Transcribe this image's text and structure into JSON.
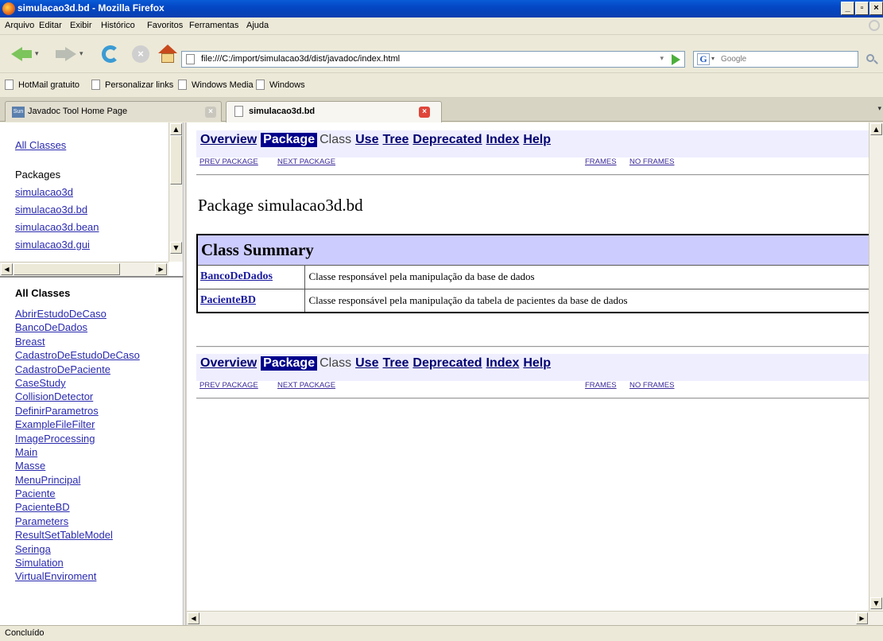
{
  "window": {
    "title": "simulacao3d.bd - Mozilla Firefox"
  },
  "menu": [
    "Arquivo",
    "Editar",
    "Exibir",
    "Histórico",
    "Favoritos",
    "Ferramentas",
    "Ajuda"
  ],
  "urlbar": {
    "url": "file:///C:/import/simulacao3d/dist/javadoc/index.html"
  },
  "search": {
    "placeholder": "Google"
  },
  "bookmarks": [
    "HotMail gratuito",
    "Personalizar links",
    "Windows Media",
    "Windows"
  ],
  "tabs": [
    {
      "label": "Javadoc Tool Home Page",
      "active": false
    },
    {
      "label": "simulacao3d.bd",
      "active": true
    }
  ],
  "packages_frame": {
    "all_classes_link": "All Classes",
    "heading": "Packages",
    "packages": [
      "simulacao3d",
      "simulacao3d.bd",
      "simulacao3d.bean",
      "simulacao3d.gui"
    ]
  },
  "classes_frame": {
    "heading": "All Classes",
    "classes": [
      "AbrirEstudoDeCaso",
      "BancoDeDados",
      "Breast",
      "CadastroDeEstudoDeCaso",
      "CadastroDePaciente",
      "CaseStudy",
      "CollisionDetector",
      "DefinirParametros",
      "ExampleFileFilter",
      "ImageProcessing",
      "Main",
      "Masse",
      "MenuPrincipal",
      "Paciente",
      "PacienteBD",
      "Parameters",
      "ResultSetTableModel",
      "Seringa",
      "Simulation",
      "VirtualEnviroment"
    ]
  },
  "doc_nav": {
    "overview": "Overview",
    "package": "Package",
    "class": "Class",
    "use": "Use",
    "tree": "Tree",
    "deprecated": "Deprecated",
    "index": "Index",
    "help": "Help",
    "prev_package": "PREV PACKAGE",
    "next_package": "NEXT PACKAGE",
    "frames": "FRAMES",
    "no_frames": "NO FRAMES"
  },
  "package_title": "Package simulacao3d.bd",
  "class_summary": {
    "heading": "Class Summary",
    "rows": [
      {
        "name": "BancoDeDados",
        "description": "Classe responsável pela manipulação da base de dados"
      },
      {
        "name": "PacienteBD",
        "description": "Classe responsável pela manipulação da tabela de pacientes da base de dados"
      }
    ]
  },
  "status": "Concluído"
}
